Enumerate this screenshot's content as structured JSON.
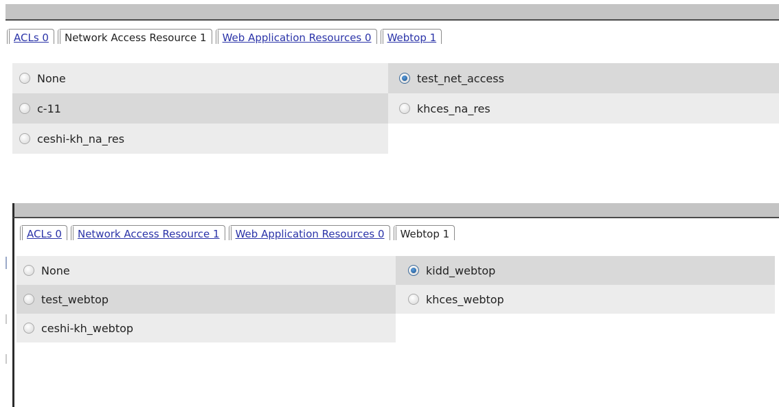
{
  "top": {
    "tabs": [
      {
        "label": "ACLs 0",
        "active": false
      },
      {
        "label": "Network Access Resource 1",
        "active": true
      },
      {
        "label": "Web Application Resources 0",
        "active": false
      },
      {
        "label": "Webtop 1",
        "active": false
      }
    ],
    "left_options": [
      {
        "label": "None",
        "selected": false
      },
      {
        "label": "c-11",
        "selected": false
      },
      {
        "label": "ceshi-kh_na_res",
        "selected": false
      }
    ],
    "right_options": [
      {
        "label": "test_net_access",
        "selected": true
      },
      {
        "label": "khces_na_res",
        "selected": false
      }
    ]
  },
  "bottom": {
    "tabs": [
      {
        "label": "ACLs 0",
        "active": false
      },
      {
        "label": "Network Access Resource 1",
        "active": false
      },
      {
        "label": "Web Application Resources 0",
        "active": false
      },
      {
        "label": "Webtop 1",
        "active": true
      }
    ],
    "left_options": [
      {
        "label": "None",
        "selected": false
      },
      {
        "label": "test_webtop",
        "selected": false
      },
      {
        "label": "ceshi-kh_webtop",
        "selected": false
      }
    ],
    "right_options": [
      {
        "label": "kidd_webtop",
        "selected": true
      },
      {
        "label": "khces_webtop",
        "selected": false
      }
    ]
  }
}
